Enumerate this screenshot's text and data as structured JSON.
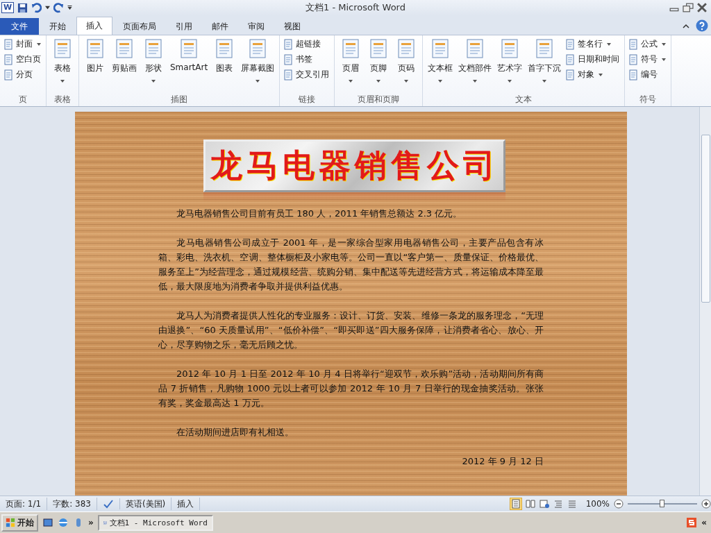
{
  "window": {
    "title": "文档1 - Microsoft Word",
    "app_badge": "W"
  },
  "tabs": [
    {
      "label": "文件",
      "kind": "file",
      "selected": false
    },
    {
      "label": "开始",
      "kind": "tab",
      "selected": false
    },
    {
      "label": "插入",
      "kind": "tab",
      "selected": true
    },
    {
      "label": "页面布局",
      "kind": "tab",
      "selected": false
    },
    {
      "label": "引用",
      "kind": "tab",
      "selected": false
    },
    {
      "label": "邮件",
      "kind": "tab",
      "selected": false
    },
    {
      "label": "审阅",
      "kind": "tab",
      "selected": false
    },
    {
      "label": "视图",
      "kind": "tab",
      "selected": false
    }
  ],
  "ribbon": {
    "groups": [
      {
        "label": "页",
        "items": [
          {
            "label": "封面",
            "kind": "small",
            "dropdown": true
          },
          {
            "label": "空白页",
            "kind": "small",
            "dropdown": false
          },
          {
            "label": "分页",
            "kind": "small",
            "dropdown": false
          }
        ]
      },
      {
        "label": "表格",
        "items": [
          {
            "label": "表格",
            "kind": "large",
            "dropdown": true
          }
        ]
      },
      {
        "label": "插图",
        "items": [
          {
            "label": "图片",
            "kind": "large",
            "dropdown": false
          },
          {
            "label": "剪贴画",
            "kind": "large",
            "dropdown": false
          },
          {
            "label": "形状",
            "kind": "large",
            "dropdown": true
          },
          {
            "label": "SmartArt",
            "kind": "large",
            "dropdown": false
          },
          {
            "label": "图表",
            "kind": "large",
            "dropdown": false
          },
          {
            "label": "屏幕截图",
            "kind": "large",
            "dropdown": true
          }
        ]
      },
      {
        "label": "链接",
        "items": [
          {
            "label": "超链接",
            "kind": "small",
            "dropdown": false
          },
          {
            "label": "书签",
            "kind": "small",
            "dropdown": false
          },
          {
            "label": "交叉引用",
            "kind": "small",
            "dropdown": false
          }
        ]
      },
      {
        "label": "页眉和页脚",
        "items": [
          {
            "label": "页眉",
            "kind": "large",
            "dropdown": true
          },
          {
            "label": "页脚",
            "kind": "large",
            "dropdown": true
          },
          {
            "label": "页码",
            "kind": "large",
            "dropdown": true
          }
        ]
      },
      {
        "label": "文本",
        "items": [
          {
            "label": "文本框",
            "kind": "large",
            "dropdown": true
          },
          {
            "label": "文档部件",
            "kind": "large",
            "dropdown": true
          },
          {
            "label": "艺术字",
            "kind": "large",
            "dropdown": true
          },
          {
            "label": "首字下沉",
            "kind": "large",
            "dropdown": true
          },
          {
            "label": "签名行",
            "kind": "small",
            "dropdown": true
          },
          {
            "label": "日期和时间",
            "kind": "small",
            "dropdown": false
          },
          {
            "label": "对象",
            "kind": "small",
            "dropdown": true
          }
        ]
      },
      {
        "label": "符号",
        "items": [
          {
            "label": "公式",
            "kind": "small",
            "dropdown": true
          },
          {
            "label": "符号",
            "kind": "small",
            "dropdown": true
          },
          {
            "label": "编号",
            "kind": "small",
            "dropdown": false
          }
        ]
      }
    ]
  },
  "document": {
    "heading": "龙马电器销售公司",
    "paragraphs": [
      {
        "text": "龙马电器销售公司目前有员工 180 人，2011 年销售总额达 2.3 亿元。",
        "kind": "body"
      },
      {
        "text": "龙马电器销售公司成立于 2001 年，是一家综合型家用电器销售公司，主要产品包含有冰箱、彩电、洗衣机、空调、整体橱柜及小家电等。公司一直以“客户第一、质量保证、价格最优、服务至上”为经营理念，通过规模经营、统购分销、集中配送等先进经营方式，将运输成本降至最低，最大限度地为消费者争取并提供利益优惠。",
        "kind": "body"
      },
      {
        "text": "龙马人为消费者提供人性化的专业服务：设计、订货、安装、维修一条龙的服务理念，“无理由退换”、“60 天质量试用”、“低价补偿”、“即买即送”四大服务保障，让消费者省心、放心、开心，尽享购物之乐，毫无后顾之忧。",
        "kind": "body"
      },
      {
        "text": "2012 年 10 月 1 日至 2012 年 10 月 4 日将举行“迎双节，欢乐购”活动，活动期间所有商品 7 折销售，凡购物 1000 元以上者可以参加 2012 年 10 月 7 日举行的现金抽奖活动。张张有奖，奖金最高达 1 万元。",
        "kind": "body"
      },
      {
        "text": "在活动期间进店即有礼相送。",
        "kind": "body"
      },
      {
        "text": "2012 年 9 月 12 日",
        "kind": "date"
      }
    ]
  },
  "status_bar": {
    "page": "页面: 1/1",
    "words": "字数: 383",
    "language": "英语(美国)",
    "mode": "插入",
    "zoom": "100%",
    "zoom_slider": {
      "level": 0.5
    }
  },
  "taskbar": {
    "start": "开始",
    "more": "»",
    "tasks": [
      {
        "label": "文档1 - Microsoft Word",
        "selected": true
      }
    ],
    "collapse": "«"
  }
}
